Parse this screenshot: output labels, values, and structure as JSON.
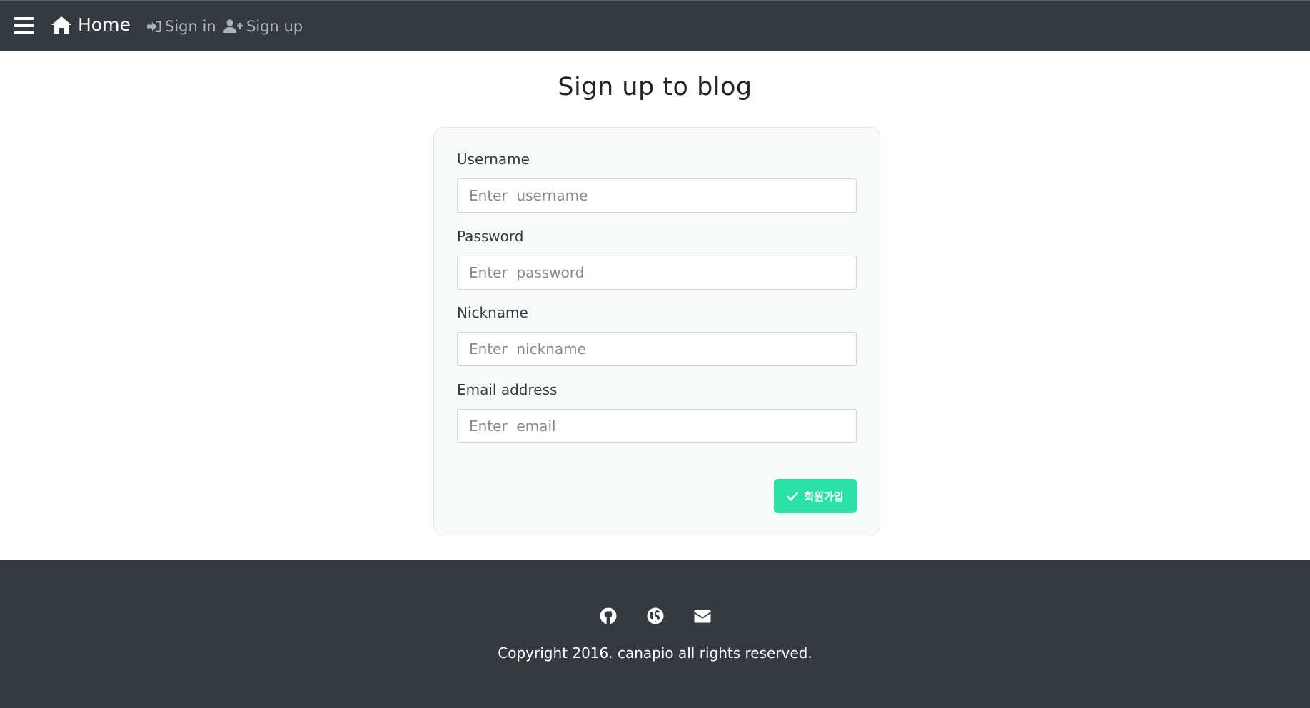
{
  "navbar": {
    "menu_icon": "hamburger-icon",
    "home_label": "Home",
    "home_icon": "house-icon",
    "signin_label": "Sign in",
    "signin_icon": "sign-in-icon",
    "signup_label": "Sign up",
    "signup_icon": "user-plus-icon"
  },
  "main": {
    "title": "Sign up to blog",
    "form": {
      "fields": [
        {
          "label": "Username",
          "placeholder": "Enter  username",
          "value": ""
        },
        {
          "label": "Password",
          "placeholder": "Enter  password",
          "value": ""
        },
        {
          "label": "Nickname",
          "placeholder": "Enter  nickname",
          "value": ""
        },
        {
          "label": "Email address",
          "placeholder": "Enter  email",
          "value": ""
        }
      ],
      "submit_label": "회원가입",
      "submit_icon": "check-icon"
    }
  },
  "footer": {
    "icons": [
      "github-icon",
      "globe-icon",
      "envelope-icon"
    ],
    "copyright": "Copyright 2016. canapio all rights reserved."
  },
  "colors": {
    "navbar_bg": "#343a40",
    "footer_bg": "#343a40",
    "accent": "#2de0a7",
    "nav_muted_text": "#aeb3b8"
  }
}
